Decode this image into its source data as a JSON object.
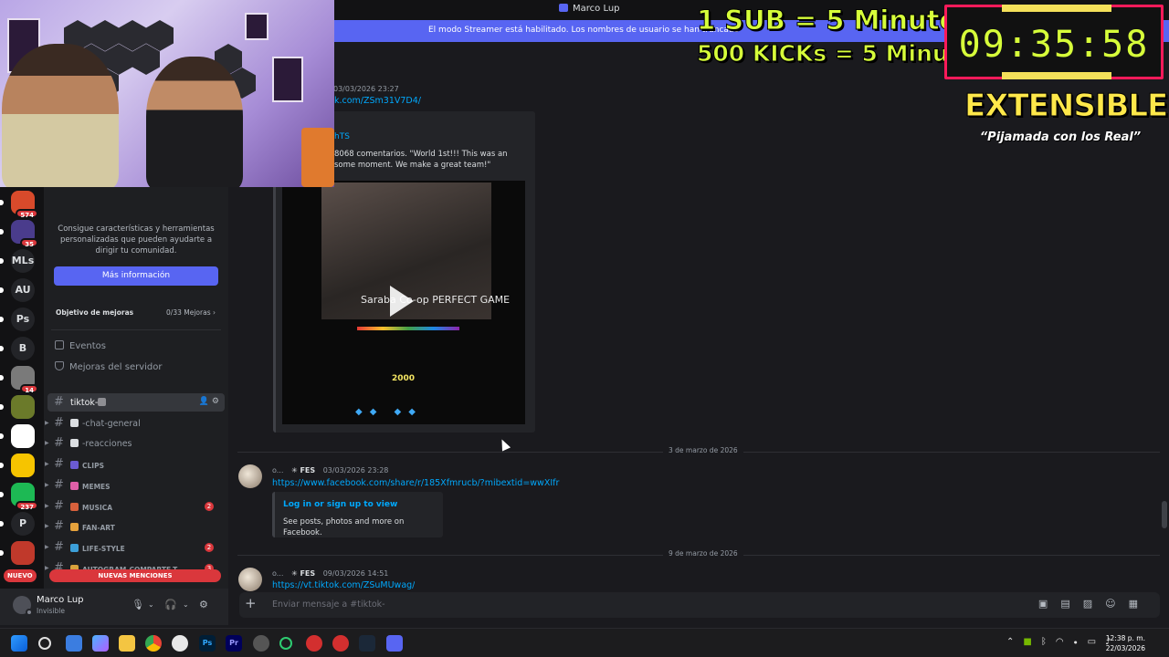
{
  "window": {
    "title": "Marco Lup"
  },
  "streamer_banner": "El modo Streamer está habilitado. Los nombres de usuario se han truncado",
  "overlay": {
    "line1": "1 SUB = 5 Minutos",
    "line2": "500 KICKs = 5 Minutos",
    "timer": "09:35:58",
    "headline": "EXTENSIBLE",
    "subtitle": "“Pijamada con los Real”"
  },
  "servers": [
    {
      "label": "",
      "badge": "574"
    },
    {
      "label": "",
      "badge": "35"
    },
    {
      "label": "MLs",
      "badge": ""
    },
    {
      "label": "AU",
      "badge": ""
    },
    {
      "label": "Ps",
      "badge": ""
    },
    {
      "label": "B",
      "badge": ""
    },
    {
      "label": "",
      "badge": "14"
    },
    {
      "label": "",
      "badge": ""
    },
    {
      "label": "",
      "badge": ""
    },
    {
      "label": "",
      "badge": ""
    },
    {
      "label": "",
      "badge": "237"
    },
    {
      "label": "P",
      "badge": ""
    },
    {
      "label": "",
      "badge": ""
    }
  ],
  "sidebar": {
    "boost_text": "Consigue características y herramientas personalizadas que pueden ayudarte a dirigir tu comunidad.",
    "more_info_button": "Más información",
    "goal_label": "Objetivo de mejoras",
    "goal_value": "0/33 Mejoras",
    "events": "Eventos",
    "boosts": "Mejoras del servidor",
    "channels": [
      {
        "name": "tiktok-",
        "active": true,
        "badge": "",
        "caps": false,
        "emoji_color": "#8e8e93"
      },
      {
        "name": "-chat-general",
        "active": false,
        "badge": "",
        "caps": false,
        "emoji_color": "#dbdee1"
      },
      {
        "name": "-reacciones",
        "active": false,
        "badge": "",
        "caps": false,
        "emoji_color": "#dbdee1"
      },
      {
        "name": "CLIPS",
        "active": false,
        "badge": "",
        "caps": true,
        "emoji_color": "#6b5bd2"
      },
      {
        "name": "MEMES",
        "active": false,
        "badge": "",
        "caps": true,
        "emoji_color": "#e05fa8"
      },
      {
        "name": "MUSICA",
        "active": false,
        "badge": "2",
        "caps": true,
        "emoji_color": "#d8613c"
      },
      {
        "name": "FAN-ART",
        "active": false,
        "badge": "",
        "caps": true,
        "emoji_color": "#e6a23c"
      },
      {
        "name": "LIFE-STYLE",
        "active": false,
        "badge": "2",
        "caps": true,
        "emoji_color": "#3c9fd8"
      },
      {
        "name": "AUTOGRAM-COMPARTE-T...",
        "active": false,
        "badge": "3",
        "caps": true,
        "emoji_color": "#d8a23c"
      }
    ],
    "new_mentions": "NUEVAS MENCIONES",
    "nuevo": "NUEVO"
  },
  "user": {
    "name": "Marco Lup",
    "status": "Invisible"
  },
  "messages": {
    "top_meta": "03/03/2026 23:27",
    "top_link": "k.com/ZSm31V7D4/",
    "embed1_title": "hTS",
    "embed1_desc": "8068 comentarios. \"World 1st!!! This was an some moment. We make a great team!\"",
    "video_label": "Saraba Co-op PERFECT GAME",
    "video_score": "2000",
    "date2": "3 de marzo de 2026",
    "msg2_author": "o...",
    "msg2_tag": "FES",
    "msg2_time": "03/03/2026 23:28",
    "msg2_link": "https://www.facebook.com/share/r/185Xfmrucb/?mibextid=wwXIfr",
    "embed2_title": "Log in or sign up to view",
    "embed2_desc": "See posts, photos and more on Facebook.",
    "date3": "9 de marzo de 2026",
    "msg3_author": "o...",
    "msg3_tag": "FES",
    "msg3_time": "09/03/2026 14:51",
    "msg3_link": "https://vt.tiktok.com/ZSuMUwag/"
  },
  "composer": {
    "placeholder": "Enviar mensaje a #tiktok-"
  },
  "taskbar": {
    "time": "12:38 p. m.",
    "date": "22/03/2026"
  }
}
